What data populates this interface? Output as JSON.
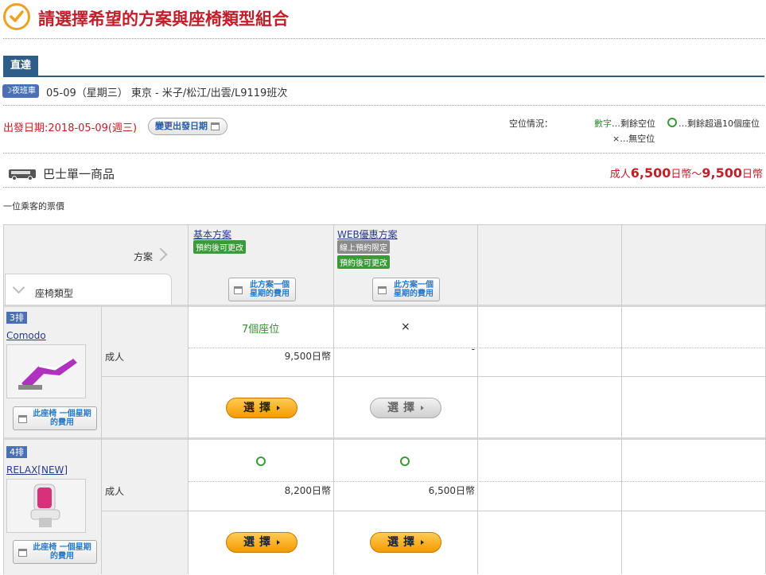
{
  "header": {
    "title": "請選擇希望的方案與座椅類型組合"
  },
  "route": {
    "tab_label": "直達",
    "night_badge": "夜班車",
    "line": "05-09（星期三） 東京 - 米子/松江/出雲/L9119班次",
    "depart_date": "出發日期:2018-05-09(週三)",
    "change_date_button": "變更出發日期"
  },
  "availability_legend": {
    "label": "空位情況：",
    "number_word": "數字",
    "number_desc": "…剩餘空位",
    "over_desc": "…剩餘超過10個座位",
    "none_desc": "×…無空位"
  },
  "product": {
    "title": "巴士單一商品",
    "price_prefix": "成人",
    "price_min": "6,500",
    "price_sep": "日幣～",
    "price_max": "9,500",
    "price_suffix": "日幣",
    "one_passenger": "一位乘客的票價"
  },
  "grid": {
    "plan_header": "方案",
    "seat_type_header": "座椅類型",
    "plans": [
      {
        "name": "基本方案",
        "tags": [
          "預約後可更改"
        ],
        "tag_colors": [
          "green"
        ],
        "week_button": "此方案一個 星期的費用"
      },
      {
        "name": "WEB優惠方案",
        "tags": [
          "線上預約限定",
          "預約後可更改"
        ],
        "tag_colors": [
          "gray",
          "green"
        ],
        "week_button": "此方案一個 星期的費用"
      }
    ],
    "rows": [
      {
        "row_badge": "3排",
        "seat_name": "Comodo",
        "seat_week_button": "此座椅 一個星期的費用",
        "pax_label": "成人",
        "cells": [
          {
            "availability": "7個座位",
            "availability_kind": "count",
            "price": "9,500日幣",
            "select_label": "選擇",
            "enabled": true
          },
          {
            "availability": "×",
            "availability_kind": "none",
            "price": "-",
            "select_label": "選擇",
            "enabled": false
          }
        ]
      },
      {
        "row_badge": "4排",
        "seat_name": "RELAX[NEW]",
        "seat_week_button": "此座椅 一個星期的費用",
        "pax_label": "成人",
        "cells": [
          {
            "availability": "",
            "availability_kind": "over10",
            "price": "8,200日幣",
            "select_label": "選擇",
            "enabled": true
          },
          {
            "availability": "",
            "availability_kind": "over10",
            "price": "6,500日幣",
            "select_label": "選擇",
            "enabled": true
          }
        ]
      }
    ]
  },
  "colors": {
    "title_red": "#c0202a",
    "tab_blue": "#2f5d8a",
    "badge_blue": "#4a6fb5",
    "green": "#3a9a3a",
    "orange": "#f49a00"
  },
  "icons": {
    "check": "check-circle-icon",
    "moon": "moon-icon",
    "calendar": "calendar-icon",
    "bus": "bus-icon"
  }
}
